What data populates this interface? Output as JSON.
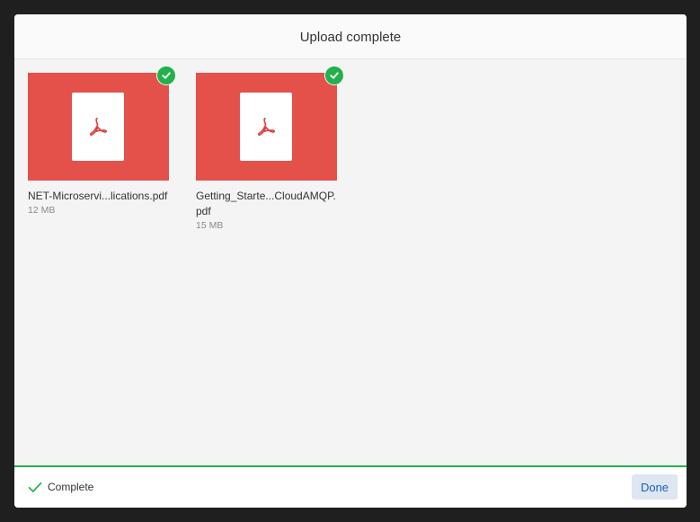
{
  "dialog": {
    "title": "Upload complete"
  },
  "files": [
    {
      "name": "NET-Microservi...lications.pdf",
      "size": "12 MB",
      "icon": "pdf-icon",
      "status_icon": "check-icon"
    },
    {
      "name": "Getting_Starte...CloudAMQP.pdf",
      "size": "15 MB",
      "icon": "pdf-icon",
      "status_icon": "check-icon"
    }
  ],
  "footer": {
    "status_icon": "checkmark-icon",
    "status_text": "Complete",
    "done_label": "Done"
  },
  "colors": {
    "thumbnail": "#e4514b",
    "success": "#23b14d",
    "done_button_bg": "#dde6f1",
    "done_button_text": "#1c5fb8"
  }
}
